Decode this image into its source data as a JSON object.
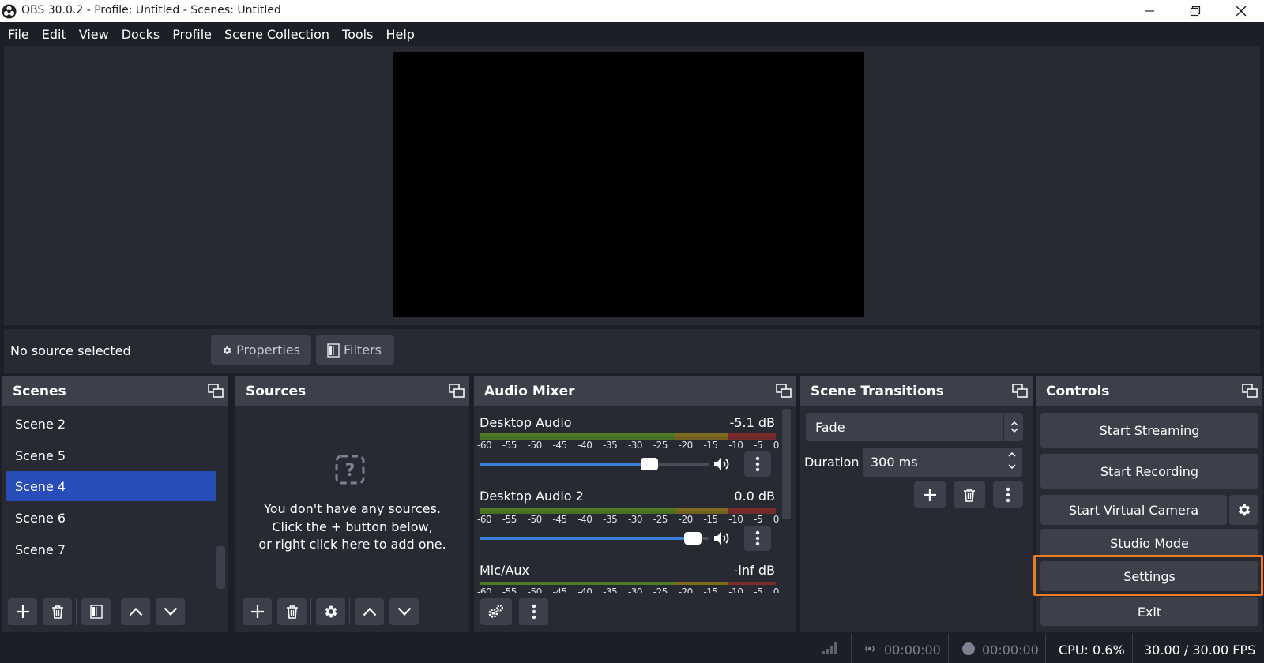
{
  "window": {
    "title": "OBS 30.0.2 - Profile: Untitled - Scenes: Untitled"
  },
  "menu": [
    "File",
    "Edit",
    "View",
    "Docks",
    "Profile",
    "Scene Collection",
    "Tools",
    "Help"
  ],
  "context_bar": {
    "status": "No source selected",
    "properties": "Properties",
    "filters": "Filters"
  },
  "scenes": {
    "title": "Scenes",
    "items": [
      "Scene 2",
      "Scene 5",
      "Scene 4",
      "Scene 6",
      "Scene 7"
    ],
    "selected": "Scene 4"
  },
  "sources": {
    "title": "Sources",
    "empty_line1": "You don't have any sources.",
    "empty_line2": "Click the + button below,",
    "empty_line3": "or right click here to add one."
  },
  "audio_mixer": {
    "title": "Audio Mixer",
    "tick_labels": [
      "-60",
      "-55",
      "-50",
      "-45",
      "-40",
      "-35",
      "-30",
      "-25",
      "-20",
      "-15",
      "-10",
      "-5",
      "0"
    ],
    "channels": [
      {
        "name": "Desktop Audio",
        "db": "-5.1 dB",
        "volume": 0.74
      },
      {
        "name": "Desktop Audio 2",
        "db": "0.0 dB",
        "volume": 0.93
      },
      {
        "name": "Mic/Aux",
        "db": "-inf dB"
      }
    ]
  },
  "scene_transitions": {
    "title": "Scene Transitions",
    "transition": "Fade",
    "duration_label": "Duration",
    "duration_value": "300 ms"
  },
  "controls": {
    "title": "Controls",
    "start_streaming": "Start Streaming",
    "start_recording": "Start Recording",
    "start_virtual_camera": "Start Virtual Camera",
    "studio_mode": "Studio Mode",
    "settings": "Settings",
    "exit": "Exit",
    "highlight_color": "#ee7b22"
  },
  "status": {
    "stream_time": "00:00:00",
    "record_time": "00:00:00",
    "cpu": "CPU: 0.6%",
    "fps": "30.00 / 30.00 FPS"
  }
}
